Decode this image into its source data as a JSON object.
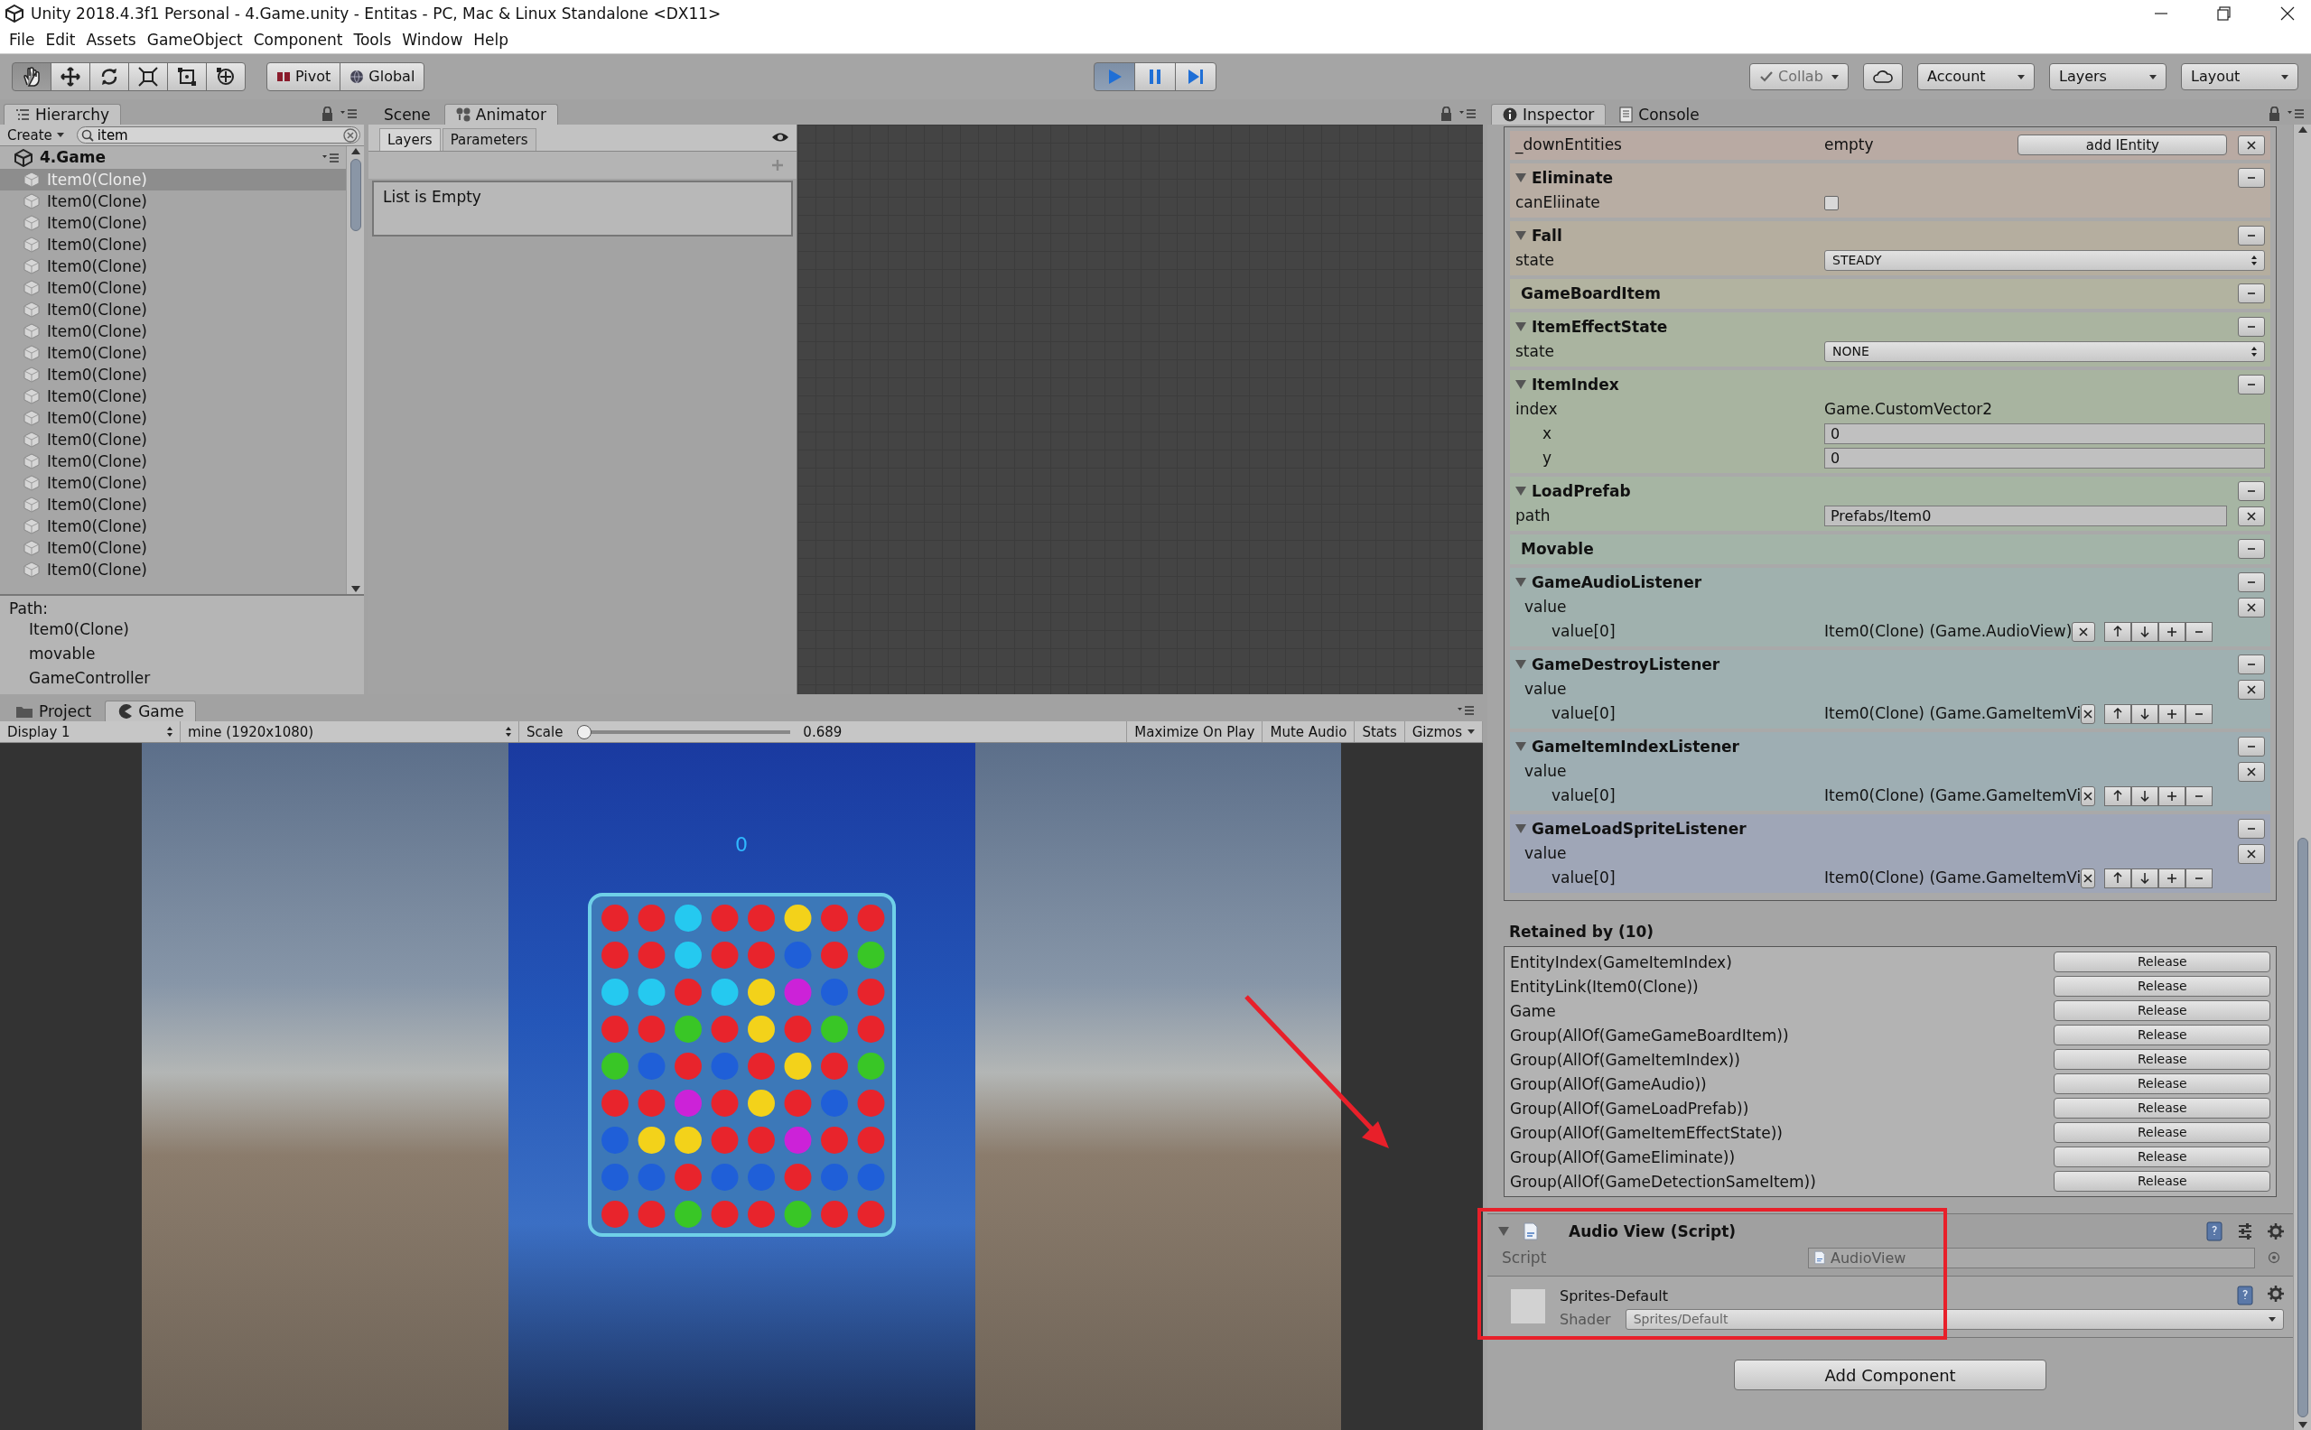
{
  "window": {
    "title": "Unity 2018.4.3f1 Personal - 4.Game.unity - Entitas - PC, Mac & Linux Standalone <DX11>"
  },
  "menu": [
    "File",
    "Edit",
    "Assets",
    "GameObject",
    "Component",
    "Tools",
    "Window",
    "Help"
  ],
  "toolbar": {
    "tools": [
      {
        "kind": "hand",
        "selected": true
      },
      {
        "kind": "move",
        "selected": false
      },
      {
        "kind": "rotate",
        "selected": false
      },
      {
        "kind": "scale",
        "selected": false
      },
      {
        "kind": "rect",
        "selected": false
      },
      {
        "kind": "transform",
        "selected": false
      }
    ],
    "pivot": "Pivot",
    "space": "Global",
    "playback": [
      {
        "kind": "play",
        "selected": true
      },
      {
        "kind": "pause",
        "selected": false
      },
      {
        "kind": "step",
        "selected": false
      }
    ],
    "right": [
      {
        "label": "Collab",
        "disabled": true
      },
      {
        "label": "Account",
        "disabled": false
      },
      {
        "label": "Layers",
        "disabled": false
      },
      {
        "label": "Layout",
        "disabled": false
      }
    ]
  },
  "hierarchy": {
    "tab": "Hierarchy",
    "create": "Create",
    "search": "item",
    "scene": "4.Game",
    "items": [
      {
        "label": "Item0(Clone)",
        "selected": true
      },
      {
        "label": "Item0(Clone)",
        "selected": false
      },
      {
        "label": "Item0(Clone)",
        "selected": false
      },
      {
        "label": "Item0(Clone)",
        "selected": false
      },
      {
        "label": "Item0(Clone)",
        "selected": false
      },
      {
        "label": "Item0(Clone)",
        "selected": false
      },
      {
        "label": "Item0(Clone)",
        "selected": false
      },
      {
        "label": "Item0(Clone)",
        "selected": false
      },
      {
        "label": "Item0(Clone)",
        "selected": false
      },
      {
        "label": "Item0(Clone)",
        "selected": false
      },
      {
        "label": "Item0(Clone)",
        "selected": false
      },
      {
        "label": "Item0(Clone)",
        "selected": false
      },
      {
        "label": "Item0(Clone)",
        "selected": false
      },
      {
        "label": "Item0(Clone)",
        "selected": false
      },
      {
        "label": "Item0(Clone)",
        "selected": false
      },
      {
        "label": "Item0(Clone)",
        "selected": false
      },
      {
        "label": "Item0(Clone)",
        "selected": false
      },
      {
        "label": "Item0(Clone)",
        "selected": false
      },
      {
        "label": "Item0(Clone)",
        "selected": false
      }
    ],
    "path_label": "Path:",
    "path": [
      "Item0(Clone)",
      "movable",
      "GameController"
    ]
  },
  "animator": {
    "tabs": [
      {
        "label": "Scene",
        "selected": false
      },
      {
        "label": "Animator",
        "selected": true
      }
    ],
    "subtabs": [
      {
        "label": "Layers",
        "selected": true
      },
      {
        "label": "Parameters",
        "selected": false
      }
    ],
    "empty": "List is Empty"
  },
  "game": {
    "tabs": [
      {
        "label": "Project",
        "kind": "folder",
        "selected": false
      },
      {
        "label": "Game",
        "kind": "game",
        "selected": true
      }
    ],
    "display": "Display 1",
    "resolution": "mine (1920x1080)",
    "scale_label": "Scale",
    "scale": {
      "level": 0,
      "reading": "0.689"
    },
    "buttons": [
      "Maximize On Play",
      "Mute Audio",
      "Stats",
      "Gizmos"
    ],
    "score": "0"
  },
  "inspector": {
    "tabs": [
      {
        "label": "Inspector",
        "kind": "info",
        "selected": true
      },
      {
        "label": "Console",
        "kind": "console",
        "selected": false
      }
    ],
    "components": [
      {
        "color": "#b9aaa3",
        "rows": [
          {
            "kind": "field",
            "label": "_downEntities",
            "value": "empty",
            "button": "add IEntity"
          }
        ]
      },
      {
        "title": "Eliminate",
        "color": "#b8ada3",
        "rows": [
          {
            "kind": "checkbox",
            "label": "canEliinate",
            "checked": false
          }
        ]
      },
      {
        "title": "Fall",
        "color": "#b5ae9f",
        "rows": [
          {
            "kind": "dropdown",
            "label": "state",
            "value": "STEADY"
          }
        ]
      },
      {
        "title": "GameBoardItem",
        "color": "#b2b3a0"
      },
      {
        "title": "ItemEffectState",
        "color": "#aab4a0",
        "rows": [
          {
            "kind": "dropdown",
            "label": "state",
            "value": "NONE"
          }
        ]
      },
      {
        "title": "ItemIndex",
        "color": "#a8b4a0",
        "rows": [
          {
            "kind": "text",
            "label": "index",
            "value": "Game.CustomVector2",
            "children": [
              {
                "kind": "input",
                "label": "x",
                "value": "0"
              },
              {
                "kind": "input",
                "label": "y",
                "value": "0"
              }
            ]
          }
        ]
      },
      {
        "title": "LoadPrefab",
        "color": "#a6b5a3",
        "rows": [
          {
            "kind": "input",
            "label": "path",
            "value": "Prefabs/Item0",
            "clearable": true
          }
        ]
      },
      {
        "title": "Movable",
        "color": "#a3b4a8"
      },
      {
        "title": "GameAudioListener",
        "color": "#a0b1ae",
        "rows": [
          {
            "kind": "list",
            "label": "value",
            "children": [
              {
                "kind": "list_item",
                "label": "value[0]",
                "value": "Item0(Clone) (Game.AudioView)"
              }
            ]
          }
        ]
      },
      {
        "title": "GameDestroyListener",
        "color": "#9fb0b1",
        "rows": [
          {
            "kind": "list",
            "label": "value",
            "children": [
              {
                "kind": "list_item",
                "label": "value[0]",
                "value": "Item0(Clone) (Game.GameItemVi"
              }
            ]
          }
        ]
      },
      {
        "title": "GameItemIndexListener",
        "color": "#9eaeb3",
        "rows": [
          {
            "kind": "list",
            "label": "value",
            "children": [
              {
                "kind": "list_item",
                "label": "value[0]",
                "value": "Item0(Clone) (Game.GameItemVi"
              }
            ]
          }
        ]
      },
      {
        "title": "GameLoadSpriteListener",
        "color": "#9fa6b7",
        "rows": [
          {
            "kind": "list",
            "label": "value",
            "children": [
              {
                "kind": "list_item",
                "label": "value[0]",
                "value": "Item0(Clone) (Game.GameItemVi"
              }
            ]
          }
        ]
      }
    ],
    "retained_title": "Retained by (10)",
    "retained": [
      {
        "name": "EntityIndex(GameItemIndex)",
        "button": "Release"
      },
      {
        "name": "EntityLink(Item0(Clone))",
        "button": "Release"
      },
      {
        "name": "Game",
        "button": "Release"
      },
      {
        "name": "Group(AllOf(GameGameBoardItem))",
        "button": "Release"
      },
      {
        "name": "Group(AllOf(GameItemIndex))",
        "button": "Release"
      },
      {
        "name": "Group(AllOf(GameAudio))",
        "button": "Release"
      },
      {
        "name": "Group(AllOf(GameLoadPrefab))",
        "button": "Release"
      },
      {
        "name": "Group(AllOf(GameItemEffectState))",
        "button": "Release"
      },
      {
        "name": "Group(AllOf(GameEliminate))",
        "button": "Release"
      },
      {
        "name": "Group(AllOf(GameDetectionSameItem))",
        "button": "Release"
      }
    ],
    "script_component": {
      "title": "Audio View (Script)",
      "script_label": "Script",
      "script": "AudioView"
    },
    "material": {
      "name": "Sprites-Default",
      "shader_label": "Shader",
      "shader": "Sprites/Default"
    },
    "add_component": "Add Component"
  }
}
